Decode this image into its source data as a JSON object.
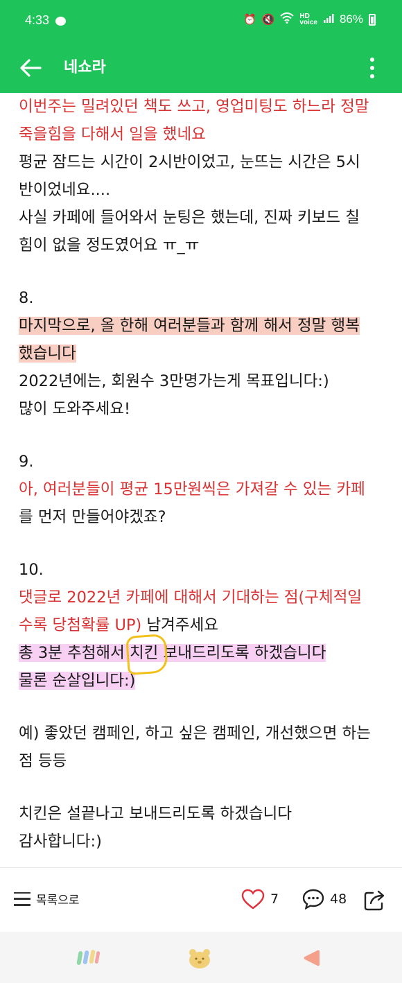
{
  "status_bar": {
    "time": "4:33",
    "battery": "86%",
    "icons": [
      "alarm-icon",
      "mute-icon",
      "wifi-icon",
      "hd-voice-icon",
      "signal-icon",
      "battery-icon"
    ]
  },
  "app_bar": {
    "title": "네쇼라",
    "back_icon": "arrow-left-icon",
    "more_icon": "more-vertical-icon",
    "color": "#1ec35a"
  },
  "post": {
    "lines": [
      {
        "text": "이번주는 밀려있던 책도 쓰고, 영업미팅도 하느라 정말",
        "style": "red"
      },
      {
        "text": "죽을힘을 다해서 일을 했네요",
        "style": "red"
      },
      {
        "text": "평균 잠드는 시간이 2시반이었고, 눈뜨는 시간은 5시",
        "style": "normal"
      },
      {
        "text": "반이었네요....",
        "style": "normal"
      },
      {
        "text": "사실 카페에 들어와서 눈팅은 했는데, 진짜 키보드 칠",
        "style": "normal"
      },
      {
        "text": "힘이 없을 정도였어요 ㅠ_ㅠ",
        "style": "normal"
      },
      {
        "text": "",
        "style": "blank"
      },
      {
        "text": "8.",
        "style": "normal"
      },
      {
        "text": "마지막으로, 올 한해 여러분들과 함께 해서 정말 행복",
        "style": "peach"
      },
      {
        "text": "했습니다",
        "style": "peach"
      },
      {
        "text": "2022년에는, 회원수 3만명가는게 목표입니다:)",
        "style": "normal"
      },
      {
        "text": "많이 도와주세요!",
        "style": "normal"
      },
      {
        "text": "",
        "style": "blank"
      },
      {
        "text": "9.",
        "style": "normal"
      },
      {
        "text": "아, 여러분들이 평균 15만원씩은 가져갈 수 있는 카페",
        "style": "red"
      },
      {
        "text": "를 먼저 만들어야겠죠?",
        "style": "normal"
      },
      {
        "text": "",
        "style": "blank"
      },
      {
        "text": "10.",
        "style": "normal"
      },
      {
        "text": "댓글로 2022년 카페에 대해서 기대하는 점(구체적일",
        "style": "red"
      },
      {
        "text": "수록 당첨확률 UP) 남겨주세요",
        "style": "mixed"
      },
      {
        "text": "총 3분 추첨해서 치킨 보내드리도록 하겠습니다",
        "style": "pink-circled"
      },
      {
        "text": "물론 순살입니다:)",
        "style": "pink"
      },
      {
        "text": "",
        "style": "blank"
      },
      {
        "text": "예) 좋았던 캠페인, 하고 싶은 캠페인, 개선했으면 하는",
        "style": "normal"
      },
      {
        "text": "점 등등",
        "style": "normal"
      },
      {
        "text": "",
        "style": "blank"
      },
      {
        "text": "치킨은 설끝나고 보내드리도록 하겠습니다",
        "style": "normal"
      },
      {
        "text": "감사합니다:)",
        "style": "normal"
      }
    ],
    "mixed_line": {
      "red_part": "수록 당첨확률 UP)",
      "normal_part": " 남겨주세요"
    },
    "circled_line": {
      "before": "총 3분 추첨해서 ",
      "circled": "치킨",
      "after": " 보내드리도록 하겠습니다"
    },
    "colors": {
      "red": "#d93233",
      "peach_highlight": "#f8cdc2",
      "pink_highlight": "#f7d0f3",
      "circle": "#f2c01a"
    }
  },
  "action_bar": {
    "list_label": "목록으로",
    "like_count": "7",
    "comment_count": "48"
  },
  "nav_bar": {
    "items": [
      "tab-logo-icon",
      "bear-icon",
      "back-triangle-icon"
    ]
  }
}
